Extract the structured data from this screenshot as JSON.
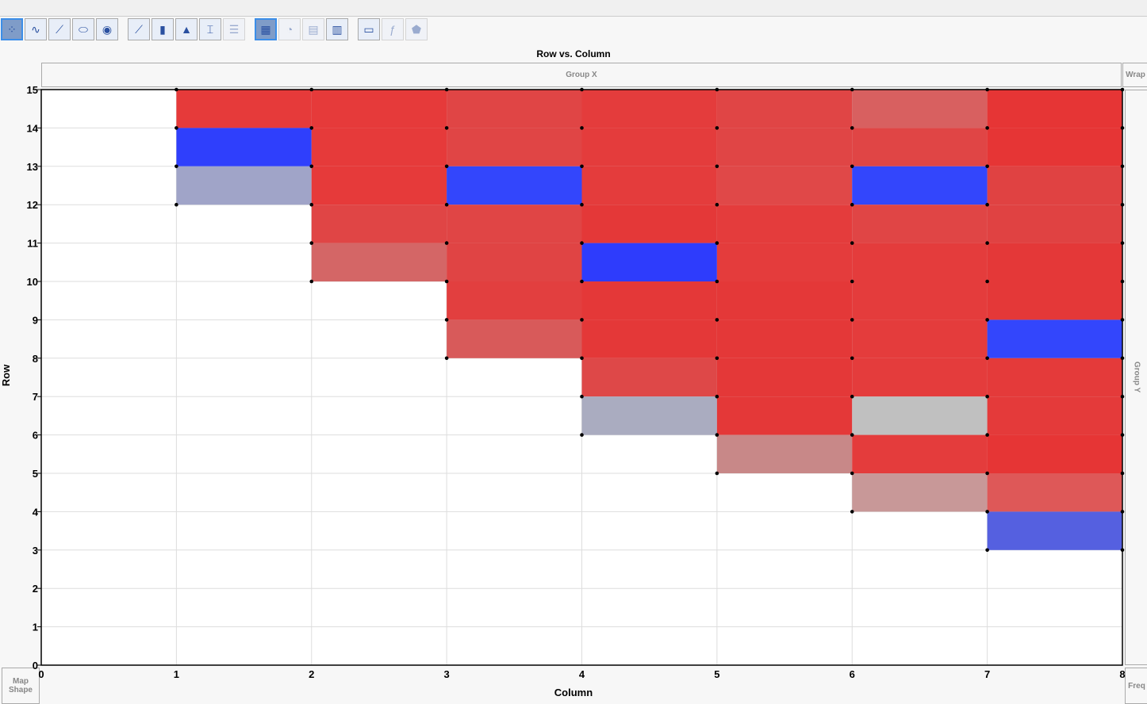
{
  "toolbar": {
    "icons": [
      "points",
      "smoother",
      "line-of-fit",
      "ellipse",
      "contour",
      "line",
      "bar",
      "area",
      "box-plot",
      "histogram",
      "heatmap",
      "pie",
      "treemap",
      "mosaic",
      "caption-box",
      "formula",
      "map-shapes"
    ],
    "selected": [
      "points",
      "heatmap"
    ]
  },
  "zones": {
    "group_x": "Group X",
    "group_y": "Group Y",
    "wrap": "Wrap",
    "map_shape": "Map Shape",
    "freq": "Freq"
  },
  "chart_data": {
    "type": "heatmap",
    "title": "Row vs. Column",
    "xlabel": "Column",
    "ylabel": "Row",
    "xlim": [
      0,
      8
    ],
    "ylim": [
      0,
      15
    ],
    "xticks": [
      "0",
      "1",
      "2",
      "3",
      "4",
      "5",
      "6",
      "7",
      "8"
    ],
    "yticks": [
      "0",
      "1",
      "2",
      "3",
      "4",
      "5",
      "6",
      "7",
      "8",
      "9",
      "10",
      "11",
      "12",
      "13",
      "14",
      "15"
    ],
    "grid": true,
    "cells": [
      {
        "col": 1,
        "row": 14,
        "color": "#e63a3a"
      },
      {
        "col": 1,
        "row": 13,
        "color": "#2f3ffc"
      },
      {
        "col": 1,
        "row": 12,
        "color": "#a0a4c8"
      },
      {
        "col": 2,
        "row": 14,
        "color": "#e63a3a"
      },
      {
        "col": 2,
        "row": 13,
        "color": "#e63a3a"
      },
      {
        "col": 2,
        "row": 12,
        "color": "#e63a3a"
      },
      {
        "col": 2,
        "row": 11,
        "color": "#e04545"
      },
      {
        "col": 2,
        "row": 10,
        "color": "#d46666"
      },
      {
        "col": 3,
        "row": 14,
        "color": "#e04545"
      },
      {
        "col": 3,
        "row": 13,
        "color": "#e04545"
      },
      {
        "col": 3,
        "row": 12,
        "color": "#3346fc"
      },
      {
        "col": 3,
        "row": 11,
        "color": "#e04545"
      },
      {
        "col": 3,
        "row": 10,
        "color": "#e04444"
      },
      {
        "col": 3,
        "row": 9,
        "color": "#e23f3f"
      },
      {
        "col": 3,
        "row": 8,
        "color": "#d85a5a"
      },
      {
        "col": 4,
        "row": 14,
        "color": "#e43c3c"
      },
      {
        "col": 4,
        "row": 13,
        "color": "#e43c3c"
      },
      {
        "col": 4,
        "row": 12,
        "color": "#e43c3c"
      },
      {
        "col": 4,
        "row": 11,
        "color": "#e43838"
      },
      {
        "col": 4,
        "row": 10,
        "color": "#2e3cfc"
      },
      {
        "col": 4,
        "row": 9,
        "color": "#e43838"
      },
      {
        "col": 4,
        "row": 8,
        "color": "#e43838"
      },
      {
        "col": 4,
        "row": 7,
        "color": "#de4848"
      },
      {
        "col": 4,
        "row": 6,
        "color": "#aaacc0"
      },
      {
        "col": 5,
        "row": 14,
        "color": "#e04545"
      },
      {
        "col": 5,
        "row": 13,
        "color": "#e04545"
      },
      {
        "col": 5,
        "row": 12,
        "color": "#e04848"
      },
      {
        "col": 5,
        "row": 11,
        "color": "#e43c3c"
      },
      {
        "col": 5,
        "row": 10,
        "color": "#e43c3c"
      },
      {
        "col": 5,
        "row": 9,
        "color": "#e43838"
      },
      {
        "col": 5,
        "row": 8,
        "color": "#e43838"
      },
      {
        "col": 5,
        "row": 7,
        "color": "#e43838"
      },
      {
        "col": 5,
        "row": 6,
        "color": "#e43838"
      },
      {
        "col": 5,
        "row": 5,
        "color": "#c88888"
      },
      {
        "col": 6,
        "row": 14,
        "color": "#d86060"
      },
      {
        "col": 6,
        "row": 13,
        "color": "#e04545"
      },
      {
        "col": 6,
        "row": 12,
        "color": "#3346fc"
      },
      {
        "col": 6,
        "row": 11,
        "color": "#e04545"
      },
      {
        "col": 6,
        "row": 10,
        "color": "#e43c3c"
      },
      {
        "col": 6,
        "row": 9,
        "color": "#e43c3c"
      },
      {
        "col": 6,
        "row": 8,
        "color": "#e43c3c"
      },
      {
        "col": 6,
        "row": 7,
        "color": "#e43c3c"
      },
      {
        "col": 6,
        "row": 6,
        "color": "#c0c0c0"
      },
      {
        "col": 6,
        "row": 5,
        "color": "#e43c3c"
      },
      {
        "col": 6,
        "row": 4,
        "color": "#c89898"
      },
      {
        "col": 7,
        "row": 14,
        "color": "#e63535"
      },
      {
        "col": 7,
        "row": 13,
        "color": "#e63535"
      },
      {
        "col": 7,
        "row": 12,
        "color": "#e04242"
      },
      {
        "col": 7,
        "row": 11,
        "color": "#e04242"
      },
      {
        "col": 7,
        "row": 10,
        "color": "#e43838"
      },
      {
        "col": 7,
        "row": 9,
        "color": "#e43838"
      },
      {
        "col": 7,
        "row": 8,
        "color": "#3346fc"
      },
      {
        "col": 7,
        "row": 7,
        "color": "#e43a3a"
      },
      {
        "col": 7,
        "row": 6,
        "color": "#e43a3a"
      },
      {
        "col": 7,
        "row": 5,
        "color": "#e63535"
      },
      {
        "col": 7,
        "row": 4,
        "color": "#de5858"
      },
      {
        "col": 7,
        "row": 3,
        "color": "#5560e0"
      }
    ]
  }
}
